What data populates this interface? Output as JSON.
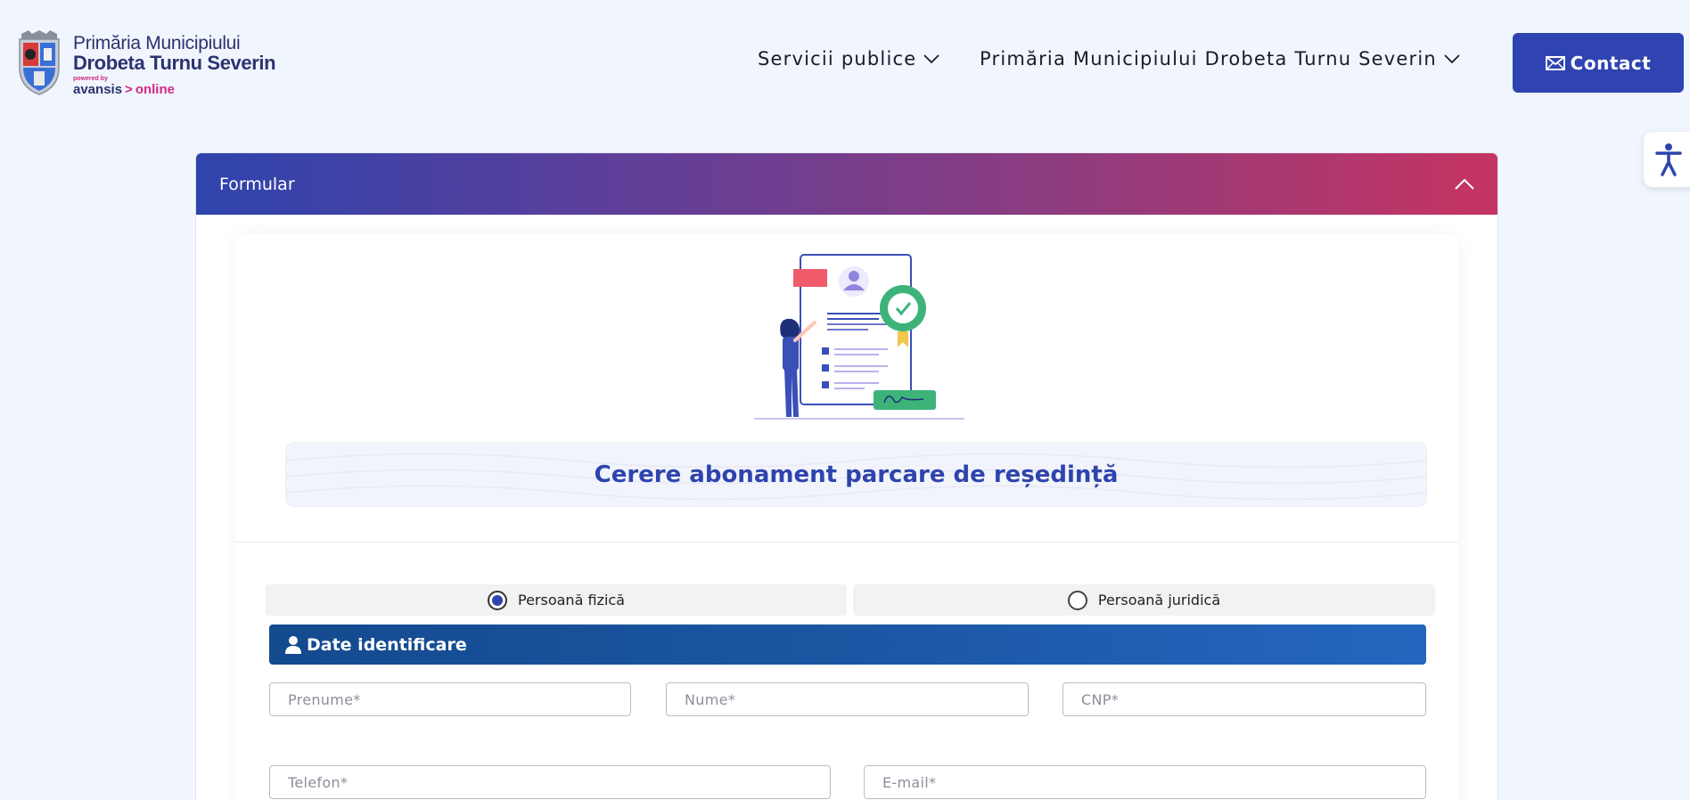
{
  "header": {
    "logo": {
      "line1": "Primăria Municipiului",
      "line2": "Drobeta Turnu Severin",
      "powered_by": "powered by",
      "brand": "avansis",
      "brand_arrow": ">",
      "brand_suffix": "online"
    },
    "nav": [
      {
        "label": "Servicii publice"
      },
      {
        "label": "Primăria Municipiului Drobeta Turnu Severin"
      }
    ],
    "contact_label": "Contact"
  },
  "form": {
    "header_title": "Formular",
    "page_title": "Cerere abonament parcare de reședință",
    "person_type": {
      "options": [
        {
          "label": "Persoană fizică",
          "selected": true
        },
        {
          "label": "Persoană juridică",
          "selected": false
        }
      ]
    },
    "section_title": "Date identificare",
    "fields": {
      "prenume": "Prenume*",
      "nume": "Nume*",
      "cnp": "CNP*",
      "telefon": "Telefon*",
      "email": "E-mail*"
    }
  },
  "colors": {
    "primary": "#2f43b1",
    "gradient_start": "#2e44ad",
    "gradient_end": "#c53462",
    "section_bar": "#1b56a3",
    "page_bg": "#f1f5fd"
  },
  "icons": [
    "crest-logo",
    "chevron-down-icon",
    "envelope-icon",
    "accessibility-icon",
    "chevron-up-icon",
    "user-icon",
    "radio-selected",
    "radio-empty"
  ]
}
